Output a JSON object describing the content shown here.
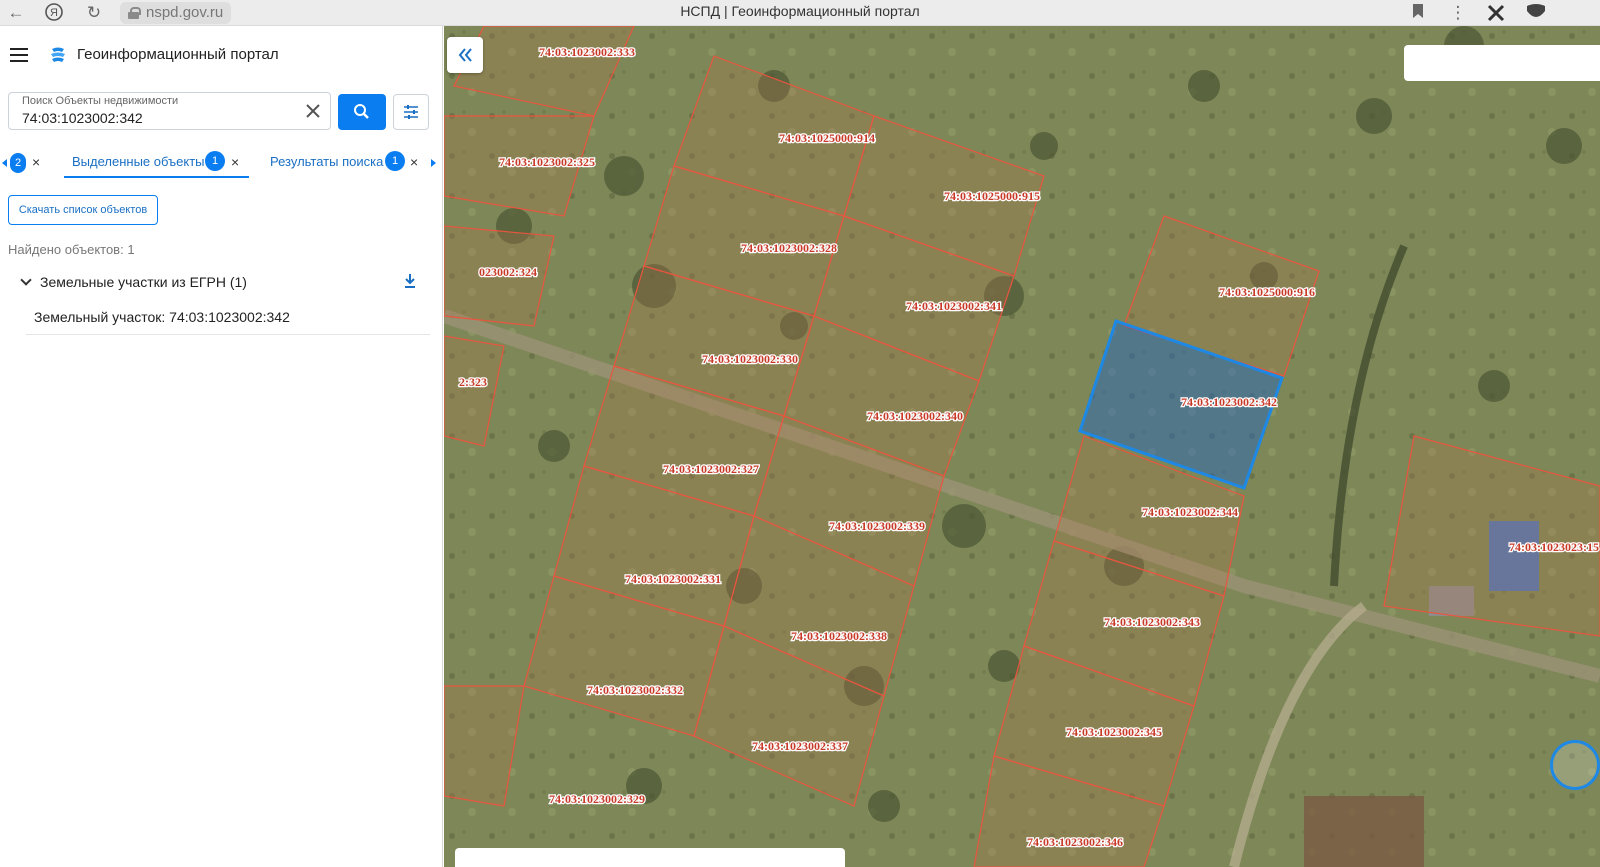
{
  "browser": {
    "url": "nspd.gov.ru",
    "title": "НСПД | Геоинформационный портал"
  },
  "app": {
    "title": "Геоинформационный портал"
  },
  "search": {
    "label": "Поиск Объекты недвижимости",
    "value": "74:03:1023002:342"
  },
  "tabs": {
    "prev_badge": "2",
    "selected": {
      "label": "Выделенные объекты",
      "badge": "1"
    },
    "results": {
      "label": "Результаты поиска",
      "badge": "1"
    }
  },
  "download_button": "Скачать список объектов",
  "found_text": "Найдено объектов: 1",
  "group": {
    "label": "Земельные участки из ЕГРН (1)",
    "items": [
      "Земельный участок: 74:03:1023002:342"
    ]
  },
  "map": {
    "selected_parcel": "74:03:1023002:342",
    "parcel_labels": [
      "74:03:1023002:333",
      "74:03:1025000:914",
      "74:03:1023002:325",
      "74:03:1025000:915",
      "74:03:1023002:328",
      "023002:324",
      "74:03:1025000:916",
      "74:03:1023002:341",
      "74:03:1023002:330",
      "2:323",
      "74:03:1023002:342",
      "74:03:1023002:340",
      "74:03:1023002:327",
      "74:03:1023002:344",
      "74:03:1023002:339",
      "74:03:1023023:15",
      "74:03:1023002:331",
      "74:03:1023002:343",
      "74:03:1023002:338",
      "74:03:1023002:332",
      "74:03:1023002:345",
      "74:03:1023002:337",
      "74:03:1023002:329",
      "74:03:1023002:346"
    ],
    "colors": {
      "boundary": "#e8553e",
      "label": "#c83a28",
      "selection": "#1e88e5"
    }
  }
}
